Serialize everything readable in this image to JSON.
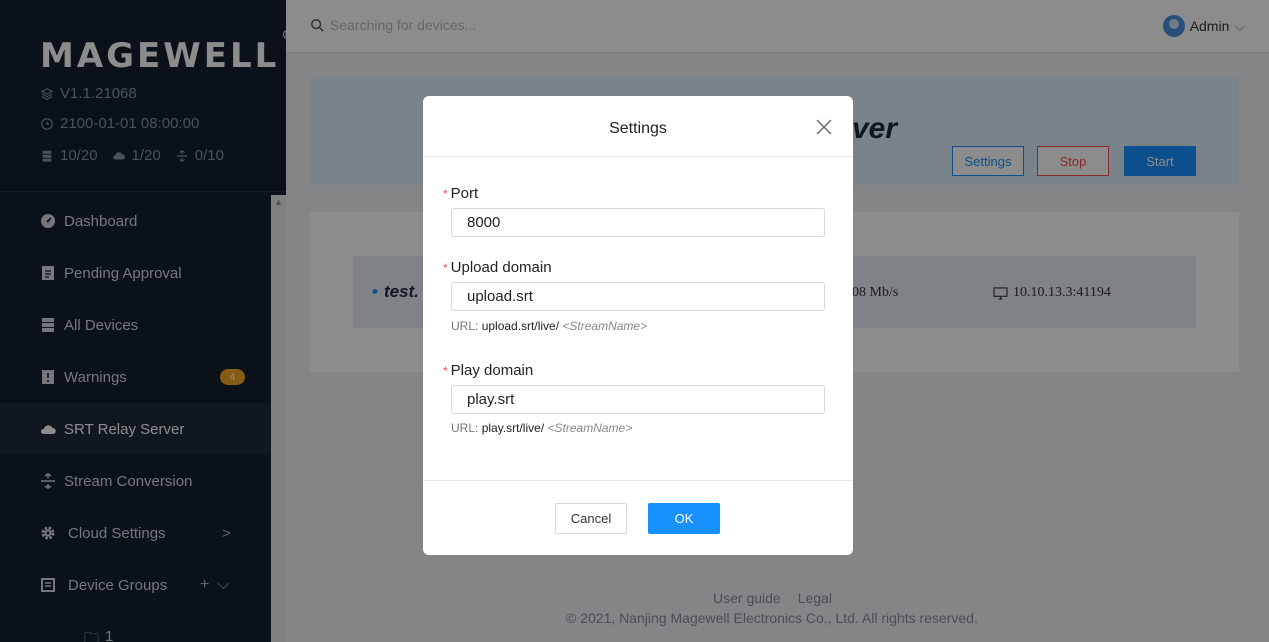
{
  "sidebar": {
    "logo": "MAGEWELL",
    "version": "V1.1.21068",
    "datetime": "2100-01-01 08:00:00",
    "counts": {
      "devices": "10/20",
      "cloud": "1/20",
      "conversion": "0/10"
    },
    "items": [
      {
        "label": "Dashboard",
        "icon": "dashboard-icon"
      },
      {
        "label": "Pending Approval",
        "icon": "clipboard-icon"
      },
      {
        "label": "All Devices",
        "icon": "server-icon"
      },
      {
        "label": "Warnings",
        "icon": "warning-doc-icon",
        "badge": "4"
      },
      {
        "label": "SRT Relay Server",
        "icon": "cloud-icon"
      },
      {
        "label": "Stream Conversion",
        "icon": "convert-icon"
      },
      {
        "label": "Cloud Settings",
        "icon": "gear-icon"
      },
      {
        "label": "Device Groups",
        "icon": "group-icon"
      }
    ],
    "subitem": "1"
  },
  "topbar": {
    "search_placeholder": "Searching for devices...",
    "user": "Admin"
  },
  "server": {
    "title": "ver",
    "buttons": {
      "settings": "Settings",
      "stop": "Stop",
      "start": "Start"
    }
  },
  "stream": {
    "name": "test.",
    "rate": "08 Mb/s",
    "ip": "10.10.13.3:41194"
  },
  "footer": {
    "links": [
      "User guide",
      "Legal"
    ],
    "copyright": "© 2021, Nanjing Magewell Electronics Co., Ltd. All rights reserved."
  },
  "modal": {
    "title": "Settings",
    "port": {
      "label": "Port",
      "value": "8000"
    },
    "upload": {
      "label": "Upload domain",
      "value": "upload.srt",
      "url_prefix": "URL: ",
      "url": "upload.srt/live/",
      "url_placeholder": "<StreamName>"
    },
    "play": {
      "label": "Play domain",
      "value": "play.srt",
      "url_prefix": "URL: ",
      "url": "play.srt/live/",
      "url_placeholder": "<StreamName>"
    },
    "cancel": "Cancel",
    "ok": "OK"
  },
  "colors": {
    "primary": "#1890ff",
    "danger": "#ff4d4f",
    "sidebar": "#141f2e",
    "badge": "#f5a623"
  }
}
